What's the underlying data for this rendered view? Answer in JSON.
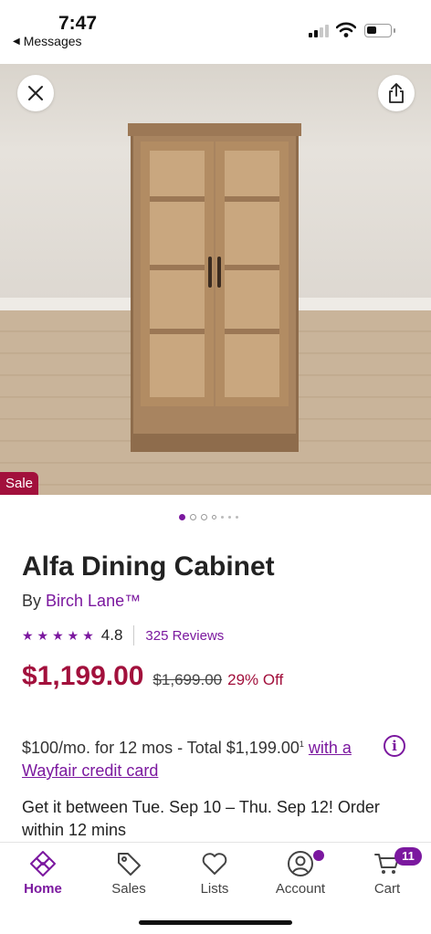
{
  "status_bar": {
    "time": "7:47",
    "back_app": "Messages",
    "icons": [
      "signal-icon",
      "wifi-icon",
      "battery-icon"
    ]
  },
  "hero": {
    "image_alt": "Alfa Dining Cabinet product photo",
    "sale_badge": "Sale",
    "carousel_total": 7,
    "carousel_active": 1
  },
  "product": {
    "title": "Alfa Dining Cabinet",
    "by_prefix": "By",
    "brand": "Birch Lane™",
    "rating": "4.8",
    "rating_stars": 5,
    "reviews": "325 Reviews"
  },
  "pricing": {
    "price": "$1,199.00",
    "was_price": "$1,699.00",
    "discount": "29% Off"
  },
  "financing": {
    "text": "$100/mo. for 12 mos - Total $1,199.00",
    "footnote": "1",
    "link": "with a Wayfair credit card"
  },
  "delivery": {
    "text": "Get it between Tue. Sep 10 – Thu. Sep 12! Order within 12 mins"
  },
  "tabbar": {
    "items": [
      {
        "label": "Home",
        "icon": "home-diamond-icon",
        "active": true
      },
      {
        "label": "Sales",
        "icon": "tag-icon"
      },
      {
        "label": "Lists",
        "icon": "heart-icon"
      },
      {
        "label": "Account",
        "icon": "account-icon"
      },
      {
        "label": "Cart",
        "icon": "cart-icon"
      }
    ],
    "cart_count": "11"
  },
  "colors": {
    "accent": "#7b189f",
    "sale": "#a2103c"
  }
}
